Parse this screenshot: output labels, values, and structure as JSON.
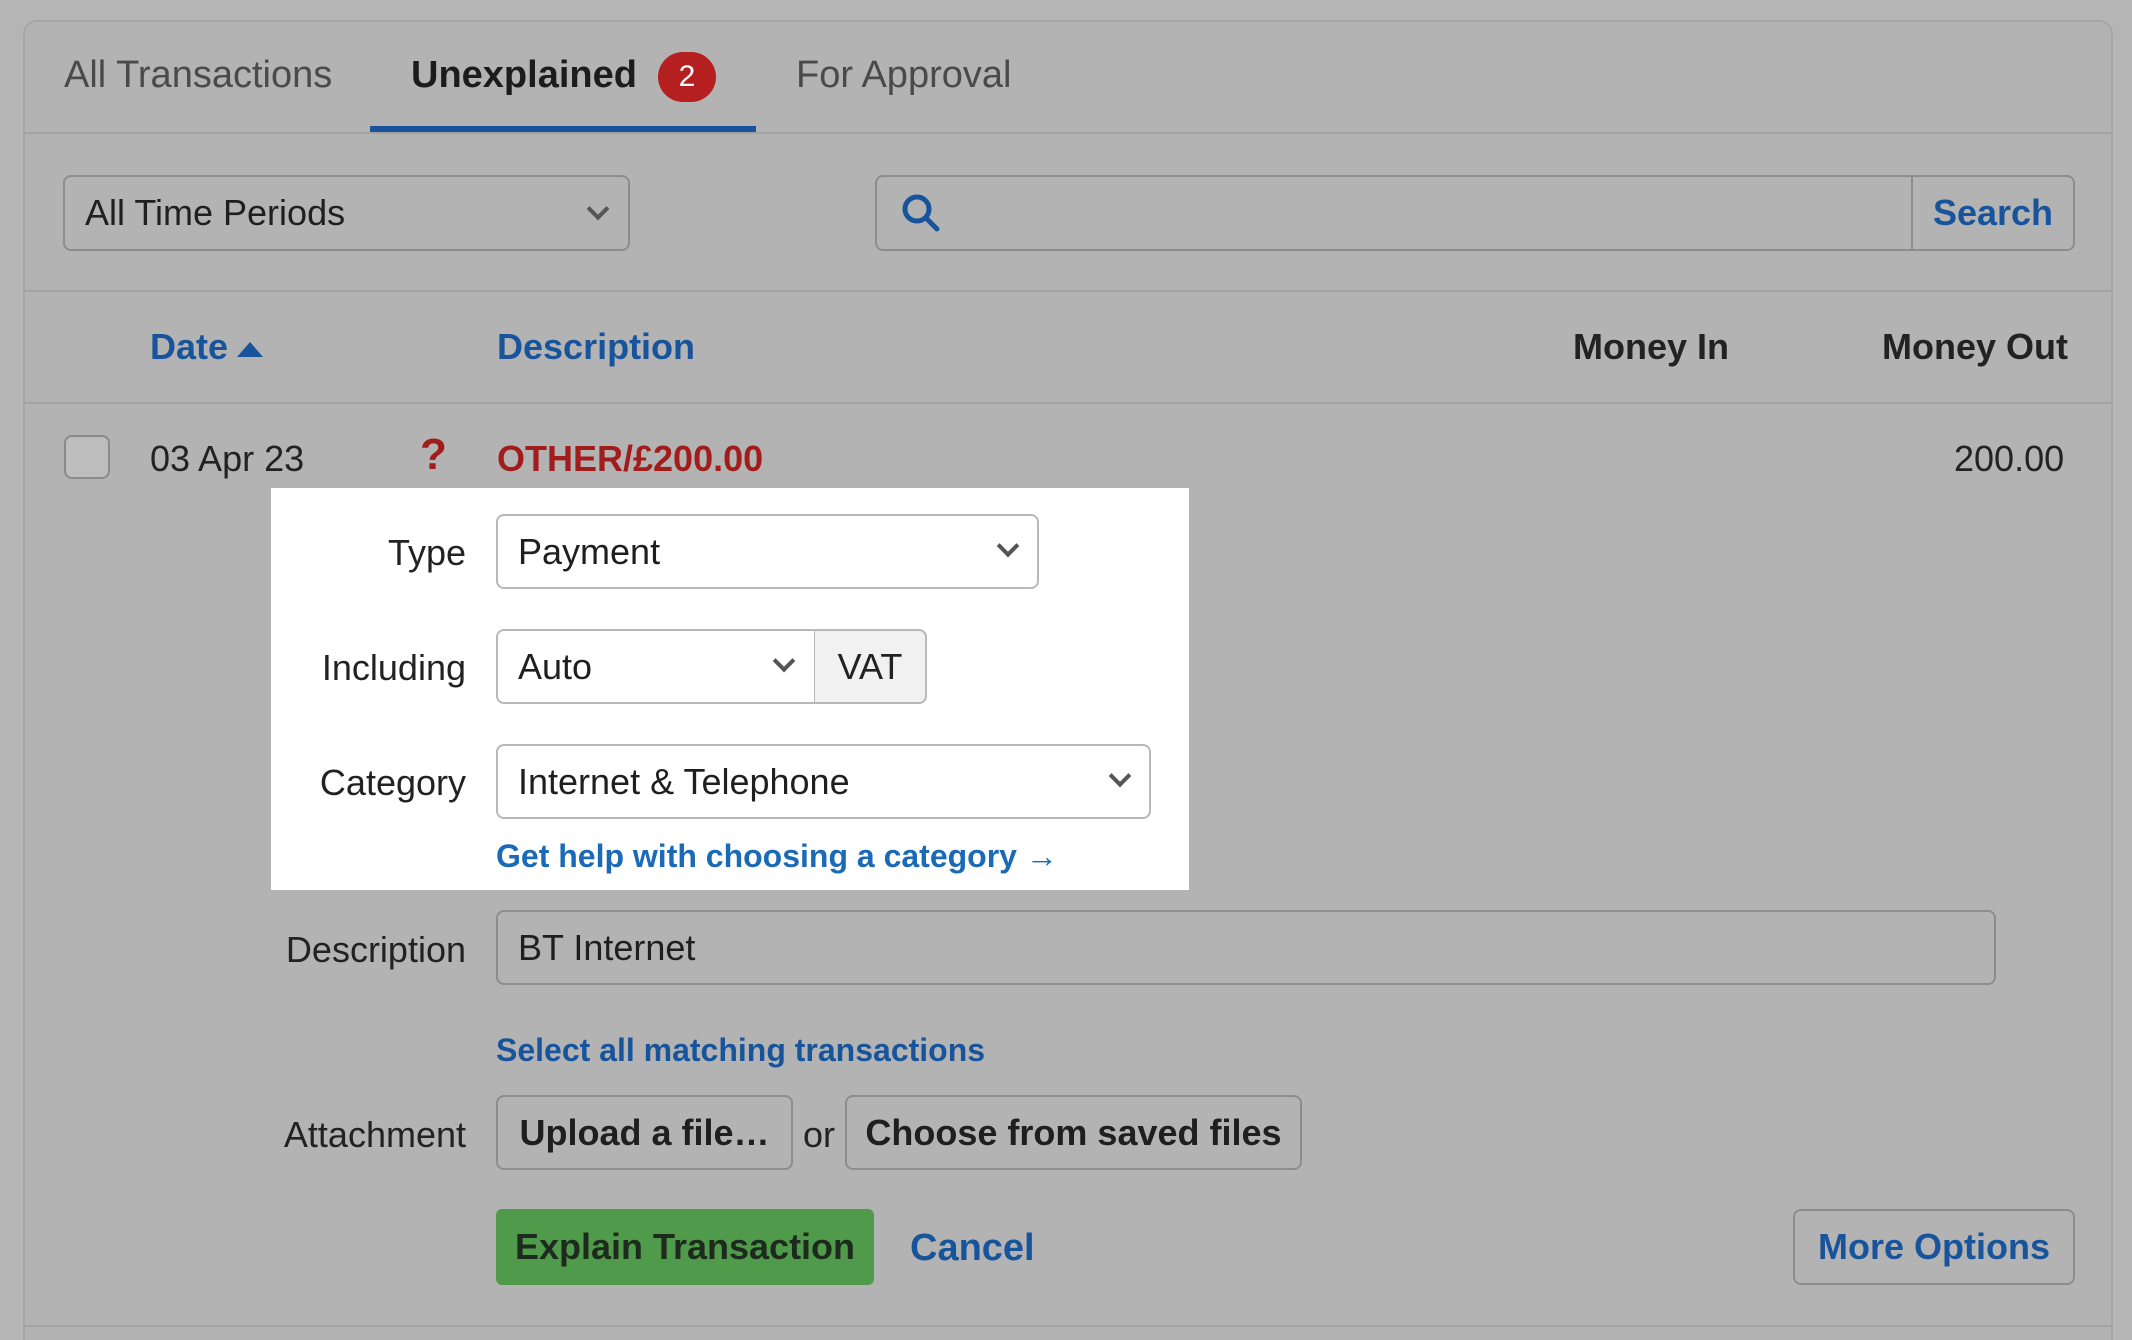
{
  "tabs": [
    {
      "label": "All Transactions"
    },
    {
      "label": "Unexplained",
      "badge": "2"
    },
    {
      "label": "For Approval"
    }
  ],
  "filters": {
    "period_value": "All Time Periods",
    "search_value": "",
    "search_button": "Search"
  },
  "table": {
    "headers": {
      "date": "Date",
      "description": "Description",
      "money_in": "Money In",
      "money_out": "Money Out"
    },
    "row": {
      "date": "03 Apr 23",
      "status_glyph": "?",
      "description": "OTHER/£200.00",
      "money_in": "",
      "money_out": "200.00"
    }
  },
  "form": {
    "type_label": "Type",
    "type_value": "Payment",
    "including_label": "Including",
    "including_value": "Auto",
    "vat_label": "VAT",
    "category_label": "Category",
    "category_value": "Internet & Telephone",
    "category_help": "Get help with choosing a category →",
    "description_label": "Description",
    "description_value": "BT Internet",
    "select_matching": "Select all matching transactions",
    "attachment_label": "Attachment",
    "upload_button": "Upload a file…",
    "or_text": "or",
    "saved_files_button": "Choose from saved files"
  },
  "actions": {
    "explain": "Explain Transaction",
    "cancel": "Cancel",
    "more_options": "More Options"
  },
  "colors": {
    "accent": "#17549b",
    "link": "#1a6ab8",
    "alert": "#a31c1c",
    "success": "#4f9a4b"
  }
}
